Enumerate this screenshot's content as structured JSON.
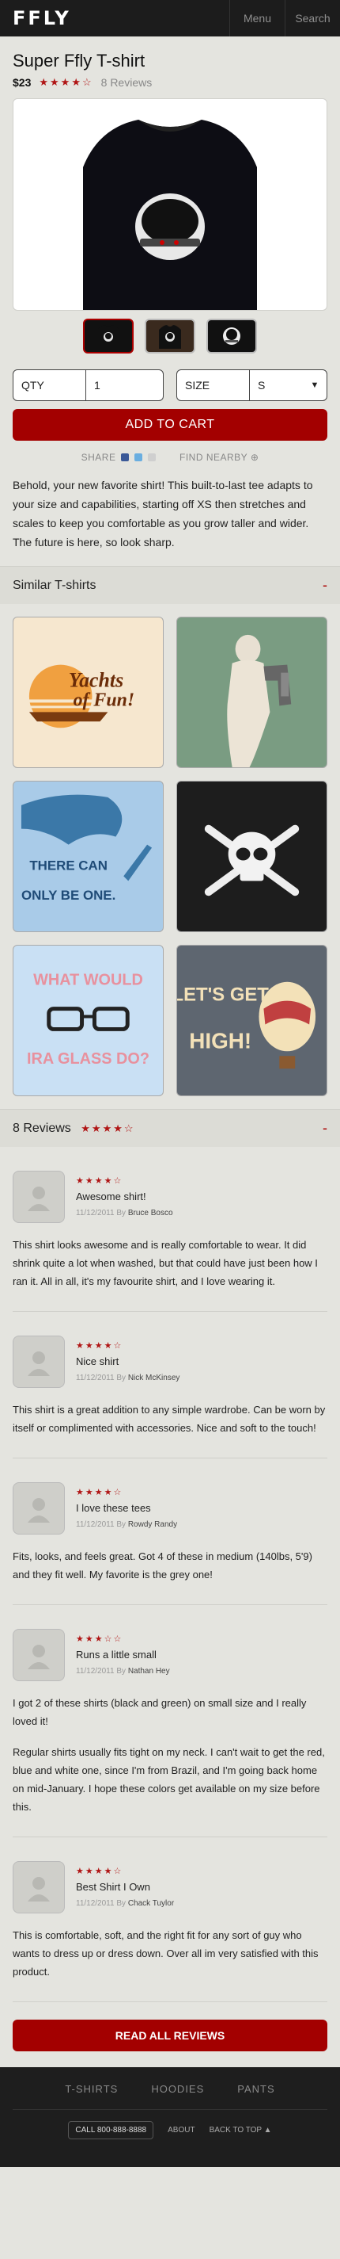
{
  "header": {
    "logo": "FFLY",
    "menu_label": "Menu",
    "search_label": "Search"
  },
  "product": {
    "title": "Super Ffly T-shirt",
    "price": "$23",
    "stars": "★★★★☆",
    "review_count": "8 Reviews",
    "qty_label": "QTY",
    "qty_value": "1",
    "size_label": "SIZE",
    "size_value": "S",
    "add_to_cart": "ADD TO CART",
    "share_label": "SHARE",
    "find_nearby_label": "FIND NEARBY",
    "description": "Behold, your new favorite shirt! This built-to-last tee adapts to your size and capabilities, starting off XS then stretches and scales to keep you comfortable as you grow taller and wider. The future is here, so look sharp."
  },
  "similar": {
    "heading": "Similar T-shirts",
    "collapse": "-",
    "tiles": [
      {
        "text1": "Yachts",
        "text2": "of Fun!",
        "bg": "#f6e7cf"
      },
      {
        "text1": "",
        "text2": "",
        "bg": "#7a9c82"
      },
      {
        "text1": "THERE CAN",
        "text2": "ONLY BE ONE.",
        "bg": "#a9cbe8"
      },
      {
        "text1": "",
        "text2": "",
        "bg": "#1d1d1d"
      },
      {
        "text1": "WHAT WOULD",
        "text2": "IRA GLASS DO?",
        "bg": "#c9e0f4"
      },
      {
        "text1": "LET'S GET",
        "text2": "HIGH!",
        "bg": "#5e6670"
      }
    ]
  },
  "reviews_section": {
    "heading": "8 Reviews",
    "stars": "★★★★☆",
    "collapse": "-",
    "by_prefix": "By",
    "items": [
      {
        "stars": "★★★★☆",
        "title": "Awesome shirt!",
        "date": "11/12/2011",
        "author": "Bruce Bosco",
        "text": "This shirt looks awesome and is really comfortable to wear. It did shrink quite a lot when washed, but that could have just been how I ran it. All in all, it's my favourite shirt, and I love wearing it."
      },
      {
        "stars": "★★★★☆",
        "title": "Nice shirt",
        "date": "11/12/2011",
        "author": "Nick McKinsey",
        "text": "This shirt is a great addition to any simple wardrobe. Can be worn by itself or complimented with accessories. Nice and soft to the touch!"
      },
      {
        "stars": "★★★★☆",
        "title": "I love these tees",
        "date": "11/12/2011",
        "author": "Rowdy Randy",
        "text": "Fits, looks, and feels great. Got 4 of these in medium (140lbs, 5'9) and they fit well. My favorite is the grey one!"
      },
      {
        "stars": "★★★☆☆",
        "title": "Runs a little small",
        "date": "11/12/2011",
        "author": "Nathan Hey",
        "text": "I got 2 of these shirts (black and green) on small size and I really loved it!",
        "text2": "Regular shirts usually fits tight on my neck. I can't wait to get the red, blue and white one, since I'm from Brazil, and I'm going back home on mid-January. I hope these colors get available on my size before this."
      },
      {
        "stars": "★★★★☆",
        "title": "Best Shirt I Own",
        "date": "11/12/2011",
        "author": "Chack Tuylor",
        "text": "This is comfortable, soft, and the right fit for any sort of guy who wants to dress up or dress down. Over all im very satisfied with this product."
      }
    ],
    "read_all": "READ ALL REVIEWS"
  },
  "footer": {
    "nav": [
      "T-SHIRTS",
      "HOODIES",
      "PANTS"
    ],
    "phone": "CALL 800-888-8888",
    "about": "ABOUT",
    "back_to_top": "BACK TO TOP ▲"
  },
  "colors": {
    "accent": "#a30000",
    "star": "#b01515",
    "header_bg": "#1c1c1c",
    "page_bg": "#e4e4df"
  },
  "icons": [
    "facebook-icon",
    "twitter-icon",
    "email-icon",
    "location-icon",
    "chevron-down-icon",
    "avatar-placeholder-icon"
  ]
}
